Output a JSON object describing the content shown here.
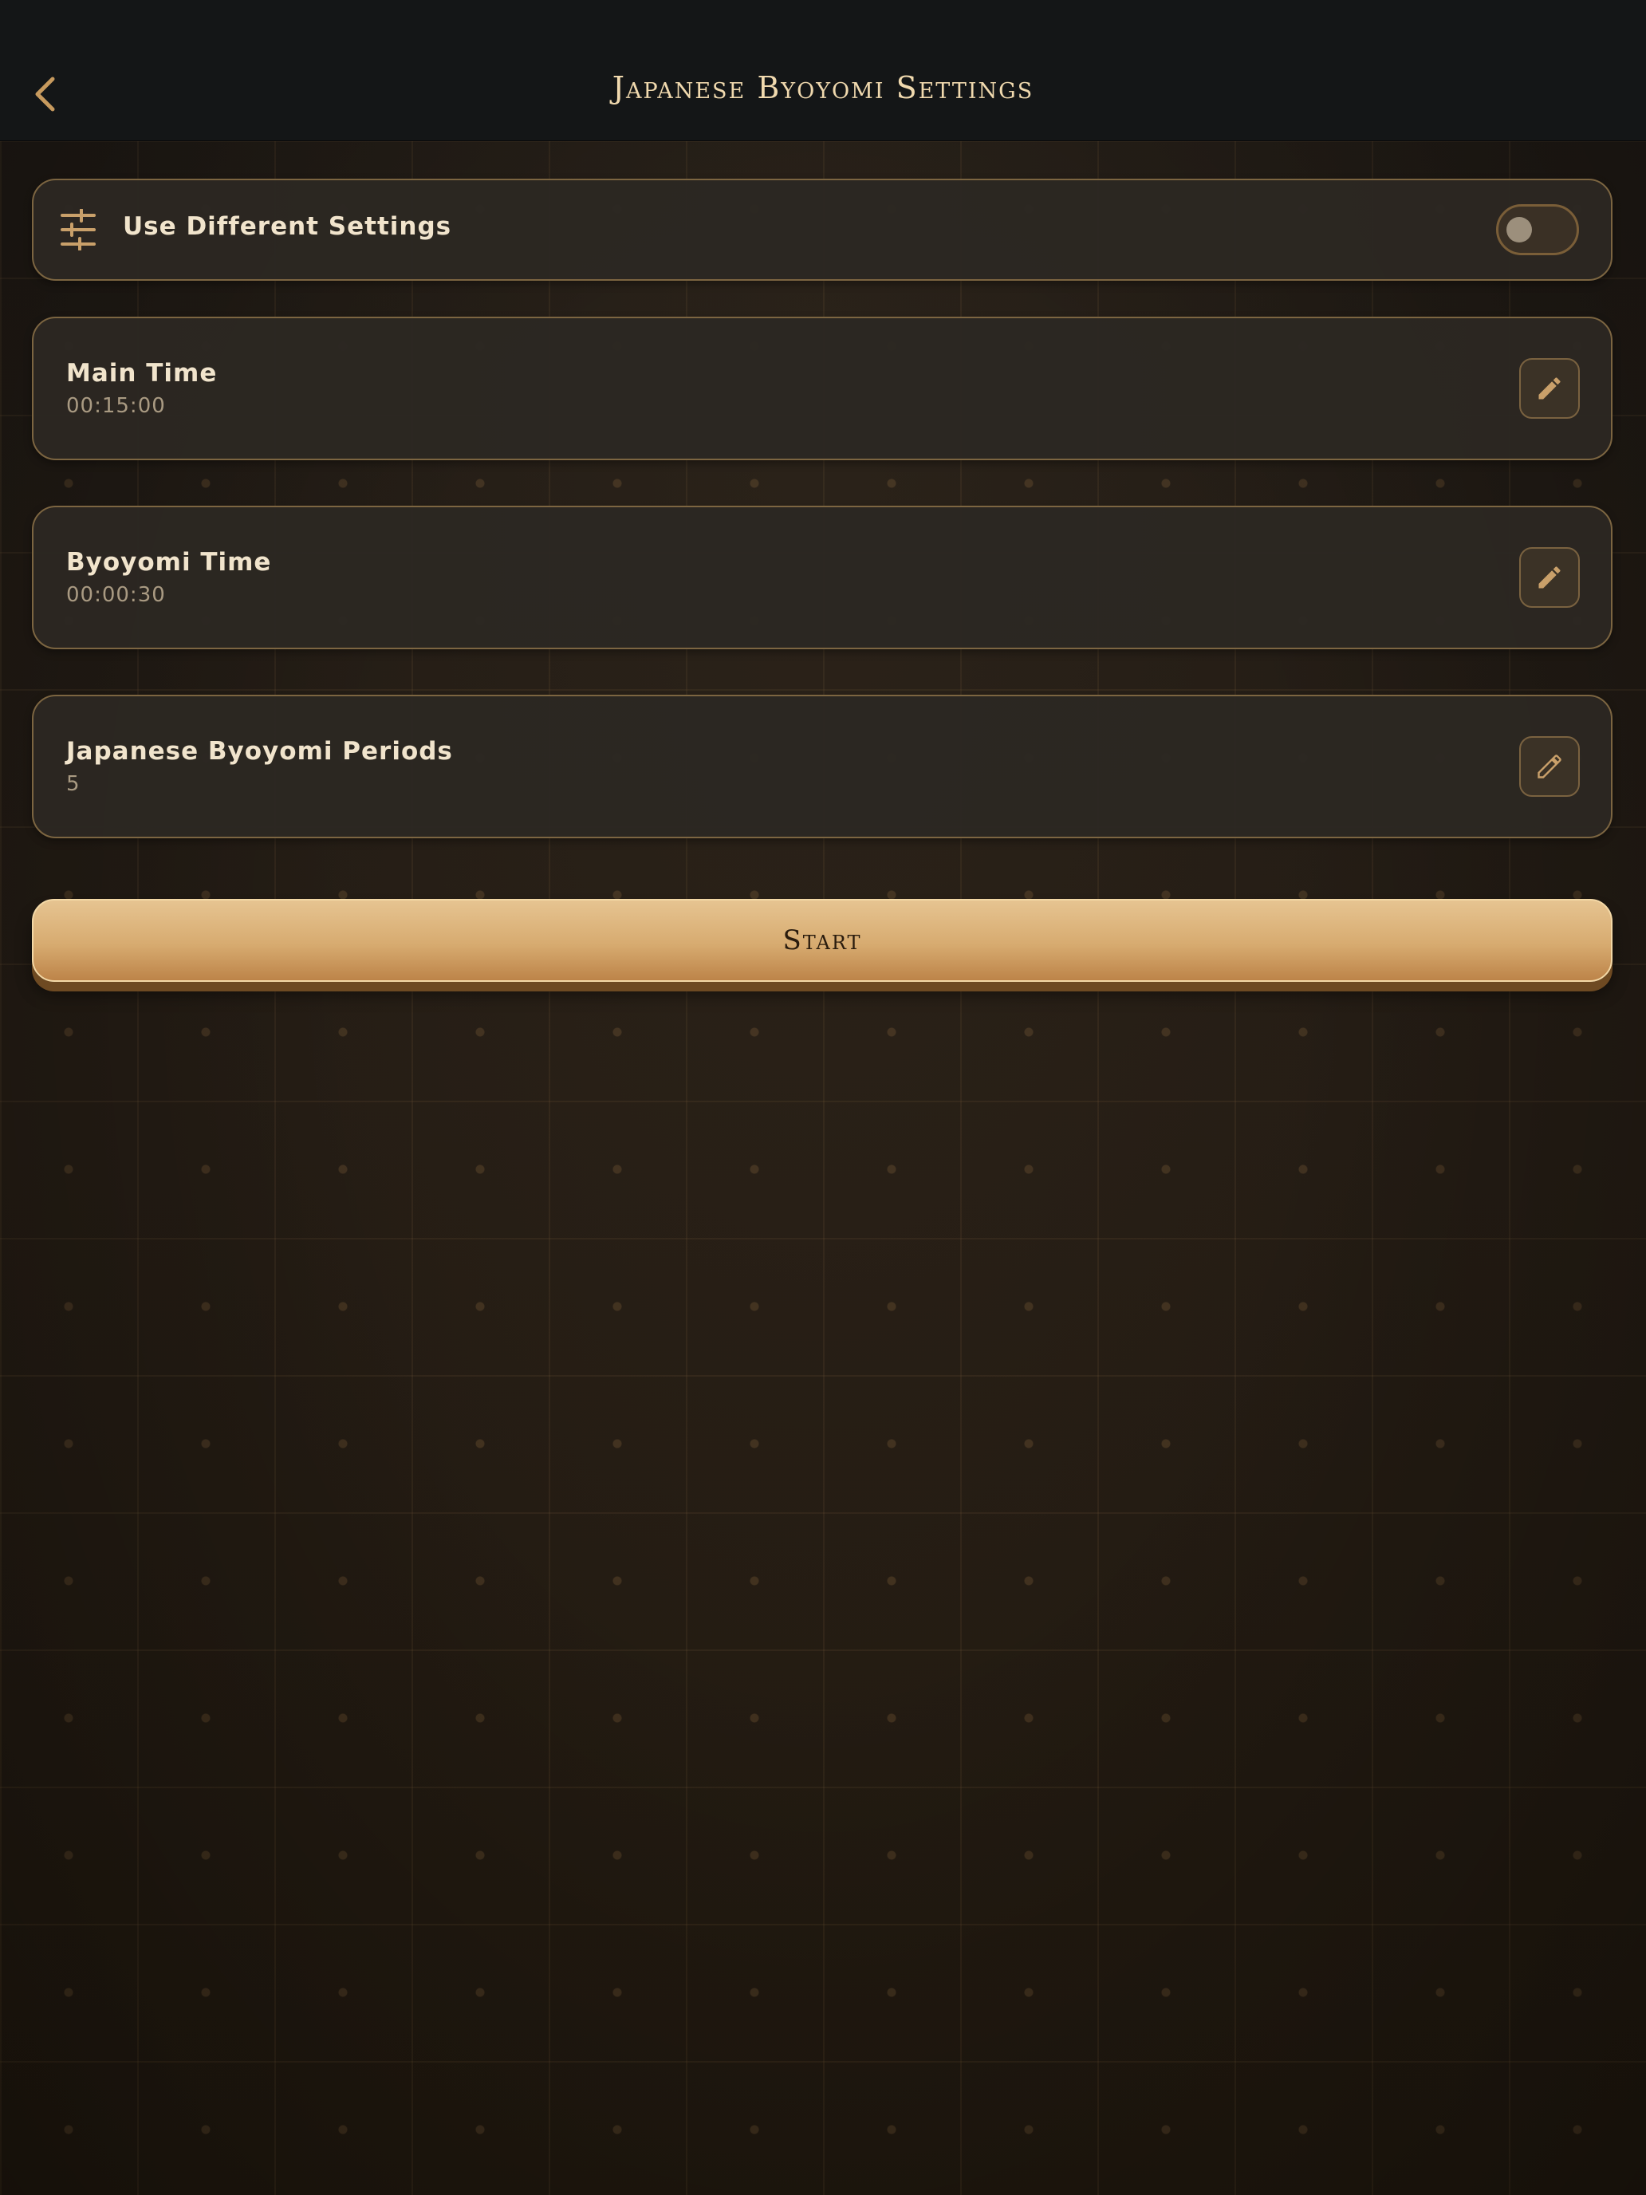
{
  "header": {
    "title": "Japanese Byoyomi Settings",
    "back_icon": "chevron-left-icon"
  },
  "toggle_setting": {
    "label": "Use Different Settings",
    "icon": "sliders-icon",
    "enabled": false
  },
  "settings": [
    {
      "label": "Main Time",
      "value": "00:15:00",
      "edit_icon": "pencil-icon"
    },
    {
      "label": "Byoyomi Time",
      "value": "00:00:30",
      "edit_icon": "pencil-icon"
    },
    {
      "label": "Japanese Byoyomi Periods",
      "value": "5",
      "edit_icon": "pencil-icon"
    }
  ],
  "start_button": {
    "label": "Start"
  },
  "colors": {
    "header_bg": "#141617",
    "accent_gold": "#d7ab70",
    "card_border": "#7c6541",
    "title_text": "#f0d9ae"
  }
}
